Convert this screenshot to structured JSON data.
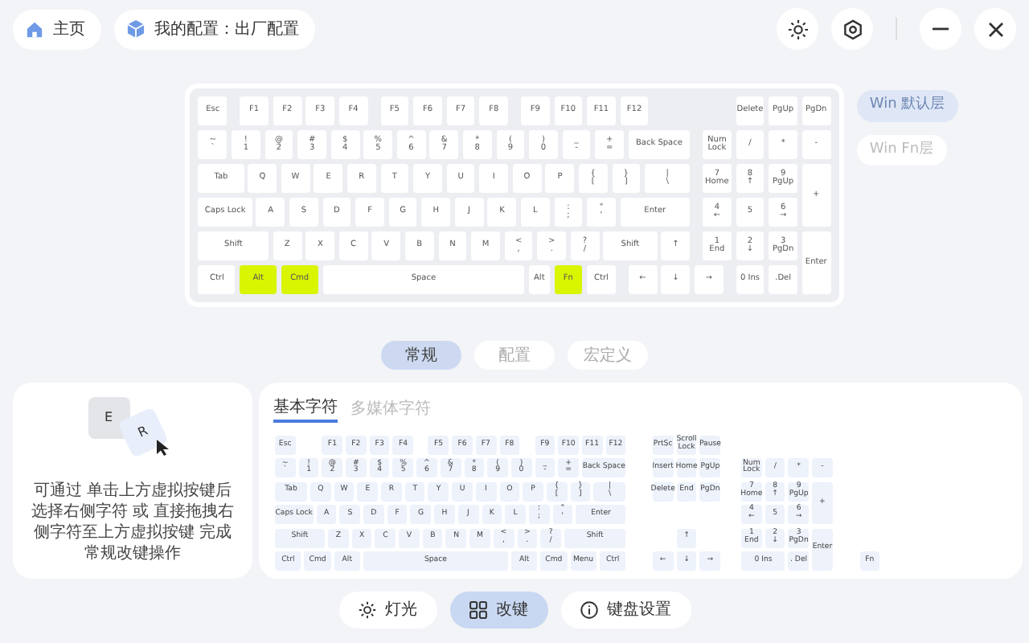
{
  "header": {
    "home": "主页",
    "profile": "我的配置：出厂配置"
  },
  "keyboard": {
    "main": [
      [
        {
          "label": "Esc",
          "highlighted": false
        },
        {
          "label": "F1",
          "highlighted": false
        },
        {
          "label": "F2",
          "highlighted": false
        },
        {
          "label": "F3",
          "highlighted": false
        },
        {
          "label": "F4",
          "highlighted": false
        },
        {
          "label": "F5",
          "highlighted": false
        },
        {
          "label": "F6",
          "highlighted": false
        },
        {
          "label": "F7",
          "highlighted": false
        },
        {
          "label": "F8",
          "highlighted": false
        },
        {
          "label": "F9",
          "highlighted": false
        },
        {
          "label": "F10",
          "highlighted": false
        },
        {
          "label": "F11",
          "highlighted": false
        },
        {
          "label": "F12",
          "highlighted": false
        }
      ],
      [
        {
          "label": "~\n`",
          "highlighted": false
        },
        {
          "label": "!\n1",
          "highlighted": false
        },
        {
          "label": "@\n2",
          "highlighted": false
        },
        {
          "label": "#\n3",
          "highlighted": false
        },
        {
          "label": "$\n4",
          "highlighted": false
        },
        {
          "label": "%\n5",
          "highlighted": false
        },
        {
          "label": "^\n6",
          "highlighted": false
        },
        {
          "label": "&\n7",
          "highlighted": false
        },
        {
          "label": "*\n8",
          "highlighted": false
        },
        {
          "label": "(\n9",
          "highlighted": false
        },
        {
          "label": ")\n0",
          "highlighted": false
        },
        {
          "label": "_\n-",
          "highlighted": false
        },
        {
          "label": "+\n=",
          "highlighted": false
        },
        {
          "label": "Back Space",
          "highlighted": false
        }
      ],
      [
        {
          "label": "Tab",
          "highlighted": false
        },
        {
          "label": "Q",
          "highlighted": false
        },
        {
          "label": "W",
          "highlighted": false
        },
        {
          "label": "E",
          "highlighted": false
        },
        {
          "label": "R",
          "highlighted": false
        },
        {
          "label": "T",
          "highlighted": false
        },
        {
          "label": "Y",
          "highlighted": false
        },
        {
          "label": "U",
          "highlighted": false
        },
        {
          "label": "I",
          "highlighted": false
        },
        {
          "label": "O",
          "highlighted": false
        },
        {
          "label": "P",
          "highlighted": false
        },
        {
          "label": "{\n[",
          "highlighted": false
        },
        {
          "label": "}\n]",
          "highlighted": false
        },
        {
          "label": "|\n\\",
          "highlighted": false
        }
      ],
      [
        {
          "label": "Caps Lock",
          "highlighted": false
        },
        {
          "label": "A",
          "highlighted": false
        },
        {
          "label": "S",
          "highlighted": false
        },
        {
          "label": "D",
          "highlighted": false
        },
        {
          "label": "F",
          "highlighted": false
        },
        {
          "label": "G",
          "highlighted": false
        },
        {
          "label": "H",
          "highlighted": false
        },
        {
          "label": "J",
          "highlighted": false
        },
        {
          "label": "K",
          "highlighted": false
        },
        {
          "label": "L",
          "highlighted": false
        },
        {
          "label": ":\n;",
          "highlighted": false
        },
        {
          "label": "\"\n'",
          "highlighted": false
        },
        {
          "label": "Enter",
          "highlighted": false
        }
      ],
      [
        {
          "label": "Shift",
          "highlighted": false
        },
        {
          "label": "Z",
          "highlighted": false
        },
        {
          "label": "X",
          "highlighted": false
        },
        {
          "label": "C",
          "highlighted": false
        },
        {
          "label": "V",
          "highlighted": false
        },
        {
          "label": "B",
          "highlighted": false
        },
        {
          "label": "N",
          "highlighted": false
        },
        {
          "label": "M",
          "highlighted": false
        },
        {
          "label": "<\n,",
          "highlighted": false
        },
        {
          "label": ">\n.",
          "highlighted": false
        },
        {
          "label": "?\n/",
          "highlighted": false
        },
        {
          "label": "Shift",
          "highlighted": false
        },
        {
          "label": "↑",
          "highlighted": false
        }
      ],
      [
        {
          "label": "Ctrl",
          "highlighted": false
        },
        {
          "label": "Alt",
          "highlighted": true
        },
        {
          "label": "Cmd",
          "highlighted": true
        },
        {
          "label": "Space",
          "highlighted": false
        },
        {
          "label": "Alt",
          "highlighted": false
        },
        {
          "label": "Fn",
          "highlighted": true
        },
        {
          "label": "Ctrl",
          "highlighted": false
        },
        {
          "label": "←",
          "highlighted": false
        },
        {
          "label": "↓",
          "highlighted": false
        },
        {
          "label": "→",
          "highlighted": false
        }
      ]
    ],
    "numpad": [
      [
        "Delete",
        "PgUp",
        "PgDn"
      ],
      [
        "Num\nLock",
        "/",
        "*",
        "-"
      ],
      [
        "7\nHome",
        "8\n↑",
        "9\nPgUp",
        "+"
      ],
      [
        "4\n←",
        "5",
        "6\n→"
      ],
      [
        "1\nEnd",
        "2\n↓",
        "3\nPgDn",
        "Enter"
      ],
      [
        "0 Ins",
        ".Del"
      ]
    ]
  },
  "layers": [
    {
      "label": "Win 默认层",
      "selected": true
    },
    {
      "label": "Win Fn层",
      "selected": false
    }
  ],
  "tabs": [
    {
      "label": "常规",
      "selected": true
    },
    {
      "label": "配置",
      "selected": false
    },
    {
      "label": "宏定义",
      "selected": false
    }
  ],
  "hint_panel": {
    "key_from": "E",
    "key_to": "R",
    "text": "可通过 单击上方虚拟按键后选择右侧字符 或 直接拖拽右侧字符至上方虚拟按键 完成常规改键操作"
  },
  "char_tabs": [
    {
      "label": "基本字符",
      "selected": true
    },
    {
      "label": "多媒体字符",
      "selected": false
    }
  ],
  "char_keyboard": {
    "main": [
      [
        "Esc",
        "F1",
        "F2",
        "F3",
        "F4",
        "F5",
        "F6",
        "F7",
        "F8",
        "F9",
        "F10",
        "F11",
        "F12"
      ],
      [
        "~\n`",
        "!\n1",
        "@\n2",
        "#\n3",
        "$\n4",
        "%\n5",
        "^\n6",
        "&\n7",
        "*\n8",
        "(\n9",
        ")\n0",
        "_\n-",
        "+\n=",
        "Back Space"
      ],
      [
        "Tab",
        "Q",
        "W",
        "E",
        "R",
        "T",
        "Y",
        "U",
        "I",
        "O",
        "P",
        "{\n[",
        "}\n]",
        "|\n\\"
      ],
      [
        "Caps Lock",
        "A",
        "S",
        "D",
        "F",
        "G",
        "H",
        "J",
        "K",
        "L",
        ":\n;",
        "\"\n'",
        "Enter"
      ],
      [
        "Shift",
        "Z",
        "X",
        "C",
        "V",
        "B",
        "N",
        "M",
        "<\n,",
        ">\n.",
        "?\n/",
        "Shift"
      ],
      [
        "Ctrl",
        "Cmd",
        "Alt",
        "Space",
        "Alt",
        "Cmd",
        "Menu",
        "Ctrl"
      ]
    ],
    "nav": [
      [
        "PrtSc",
        "Scroll\nLock",
        "Pause"
      ],
      [
        "Insert",
        "Home",
        "PgUp"
      ],
      [
        "Delete",
        "End",
        "PgDn"
      ]
    ],
    "arrows": [
      [
        "↑"
      ],
      [
        "←",
        "↓",
        "→"
      ]
    ],
    "numpad": [
      [
        "Num\nLock",
        "/",
        "*",
        "-"
      ],
      [
        "7\nHome",
        "8\n↑",
        "9\nPgUp",
        "+"
      ],
      [
        "4\n←",
        "5",
        "6\n→"
      ],
      [
        "1\nEnd",
        "2\n↓",
        "3\nPgDn",
        "Enter"
      ],
      [
        "0 Ins",
        ". Del"
      ]
    ],
    "fn_key": "Fn"
  },
  "bottom_nav": [
    {
      "label": "灯光",
      "kind": "lighting",
      "selected": false
    },
    {
      "label": "改键",
      "kind": "remap",
      "selected": true
    },
    {
      "label": "键盘设置",
      "kind": "settings",
      "selected": false
    }
  ]
}
